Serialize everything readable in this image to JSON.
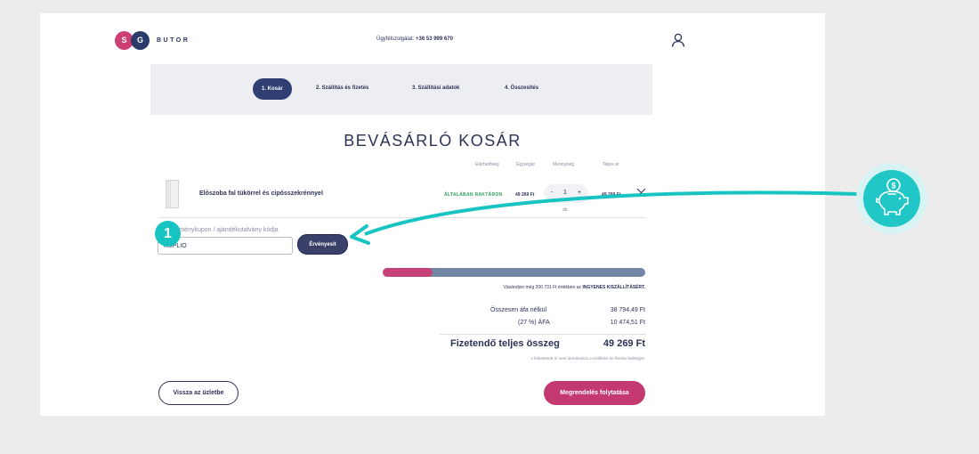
{
  "header": {
    "logo_letters": [
      "S",
      "G"
    ],
    "logo_word": "BUTOR",
    "support_label": "Ügyfélszolgálat:",
    "support_phone": "+36 53 999 670",
    "user_icon": "user-icon"
  },
  "steps": [
    {
      "label": "1.   Kosár",
      "active": true
    },
    {
      "label": "2.   Szállítás és fizetés",
      "active": false
    },
    {
      "label": "3.   Szállítási adatok",
      "active": false
    },
    {
      "label": "4.   Összesítés",
      "active": false
    }
  ],
  "page_title": "BEVÁSÁRLÓ KOSÁR",
  "cart": {
    "columns": {
      "availability": "Elérhetőség",
      "unit_price": "Egységár",
      "quantity": "Mennyiség",
      "total_price": "Teljes ár"
    },
    "item": {
      "name": "Előszoba fal tükörrel és cipősszekrénnyel",
      "availability": "ÁLTALÁBAN RAKTÁRON",
      "unit_price": "49 269 Ft",
      "qty_minus": "-",
      "quantity": "1",
      "qty_plus": "+",
      "unit": "db",
      "total_price": "49 269 Ft"
    }
  },
  "coupon": {
    "label": "Kedvezménykupon / ajándékutalvány kódja",
    "value": "KUPLIO",
    "apply_label": "Érvényesít"
  },
  "annotation": {
    "badge_number": "1",
    "color": "#17c4c2",
    "piggy_icon": "piggy-bank-coin-icon"
  },
  "shipping_progress": {
    "fraction": 0.19,
    "text_prefix": "Vásároljon még 200 731 Ft értékben az",
    "text_bold": "INGYENES KISZÁLLÍTÁSÉRT."
  },
  "summary": {
    "net_label": "Összesen áfa nélkül",
    "net_value": "38 794,49 Ft",
    "vat_label": "(27 %) ÁFA",
    "vat_value": "10 474,51 Ft",
    "total_label": "Fizetendő teljes összeg",
    "total_value": "49 269 Ft",
    "note": "A feltüntetett ár nem tartalmazza a szállítási és fizetési költséget."
  },
  "actions": {
    "back_label": "Vissza az üzletbe",
    "continue_label": "Megrendelés folytatása"
  },
  "colors": {
    "brand_navy": "#2b3357",
    "brand_pink": "#c4396f",
    "available_green": "#2e9f5a"
  }
}
